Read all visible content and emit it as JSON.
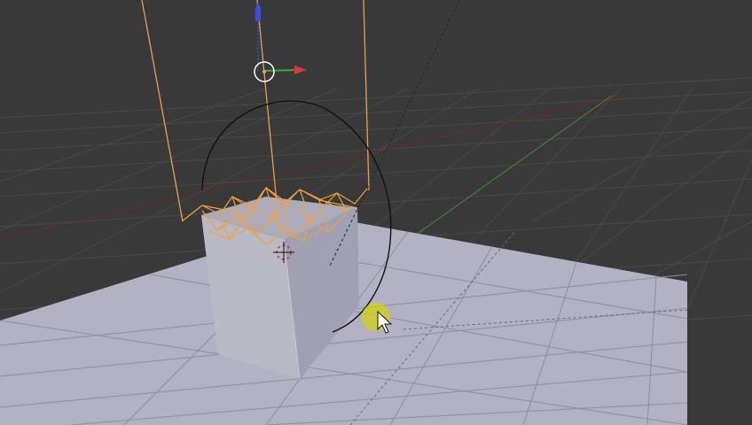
{
  "app": {
    "name": "3D viewport"
  },
  "viewport": {
    "background": "#393939",
    "grid_color": "#4a4a4a",
    "floor_color": "#b2b2c4",
    "floor_grid_color": "#8e8ea0",
    "x_axis_color": "#6b2a2a",
    "y_axis_color": "#3f8a3f"
  },
  "objects": {
    "cube": {
      "face_left": "#b8b9c4",
      "face_right": "#9fa0b2",
      "top": "#a9abbe"
    },
    "selection_color": "#f0a040",
    "rope_color": "#e8a050",
    "curve_color": "#111111"
  },
  "gizmo": {
    "x_color": "#d23b3b",
    "y_color": "#38b038",
    "z_color": "#3a4fe0",
    "center_ring": "#ffffff"
  },
  "cursor": {
    "icon": "cursor-icon",
    "highlight_color": "#d6d600"
  },
  "icons": [
    "3d-cursor-icon",
    "transform-gizmo-icon",
    "cursor-icon"
  ]
}
